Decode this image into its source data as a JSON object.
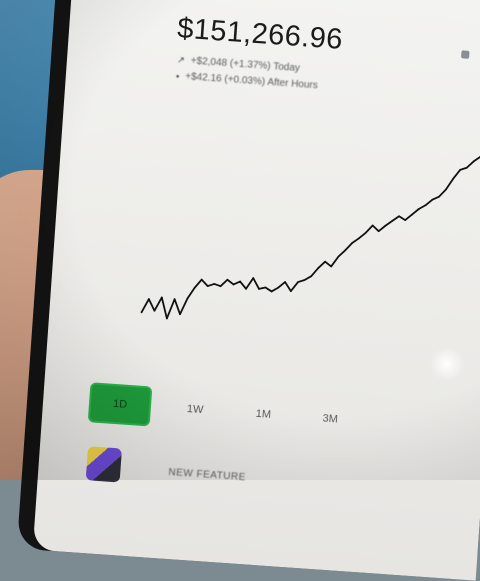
{
  "portfolio": {
    "balance": "$151,266.96",
    "change_today": "+$2,048 (+1.37%) Today",
    "change_after_hours": "+$42.16 (+0.03%) After Hours"
  },
  "chart_data": {
    "type": "line",
    "title": "",
    "xlabel": "",
    "ylabel": "",
    "y": [
      145000,
      146600,
      145300,
      146900,
      144500,
      146800,
      145100,
      147000,
      148300,
      149300,
      148600,
      148900,
      148700,
      149500,
      149000,
      149400,
      148600,
      149900,
      148700,
      148900,
      148500,
      149000,
      149700,
      148700,
      149800,
      150100,
      150600,
      151600,
      152400,
      151900,
      153100,
      153900,
      154800,
      155400,
      156100,
      157000,
      156400,
      157100,
      157700,
      158300,
      157900,
      158600,
      159300,
      159800,
      160500,
      160900,
      161800,
      163100,
      164200,
      164500,
      165300,
      165900,
      165600,
      166000
    ],
    "line_color": "#111111"
  },
  "range_tabs": [
    {
      "label": "1D",
      "active": true
    },
    {
      "label": "1W",
      "active": false
    },
    {
      "label": "1M",
      "active": false
    },
    {
      "label": "3M",
      "active": false
    }
  ],
  "banner": {
    "label": "NEW FEATURE"
  },
  "colors": {
    "accent": "#1e9a3a",
    "screen": "#f1f1ef",
    "device": "#131313"
  }
}
